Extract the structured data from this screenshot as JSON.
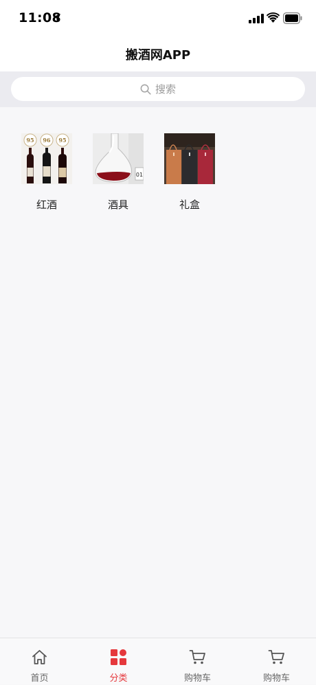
{
  "status_bar": {
    "time": "11:08"
  },
  "nav": {
    "title": "搬酒网APP"
  },
  "search": {
    "placeholder": "搜索"
  },
  "categories": [
    {
      "label": "红酒",
      "thumb_badges": [
        "95",
        "96",
        "95"
      ]
    },
    {
      "label": "酒具",
      "thumb_badges": [
        "01"
      ]
    },
    {
      "label": "礼盒"
    }
  ],
  "tab_bar": {
    "tabs": [
      {
        "label": "首页",
        "icon": "home-icon",
        "active": false
      },
      {
        "label": "分类",
        "icon": "category-icon",
        "active": true
      },
      {
        "label": "购物车",
        "icon": "cart-icon",
        "active": false
      },
      {
        "label": "购物车",
        "icon": "cart-icon",
        "active": false
      }
    ]
  },
  "colors": {
    "accent": "#e5383c",
    "tab_inactive": "#666666",
    "search_bg": "#ebebf0",
    "page_bg": "#f7f7f9"
  }
}
